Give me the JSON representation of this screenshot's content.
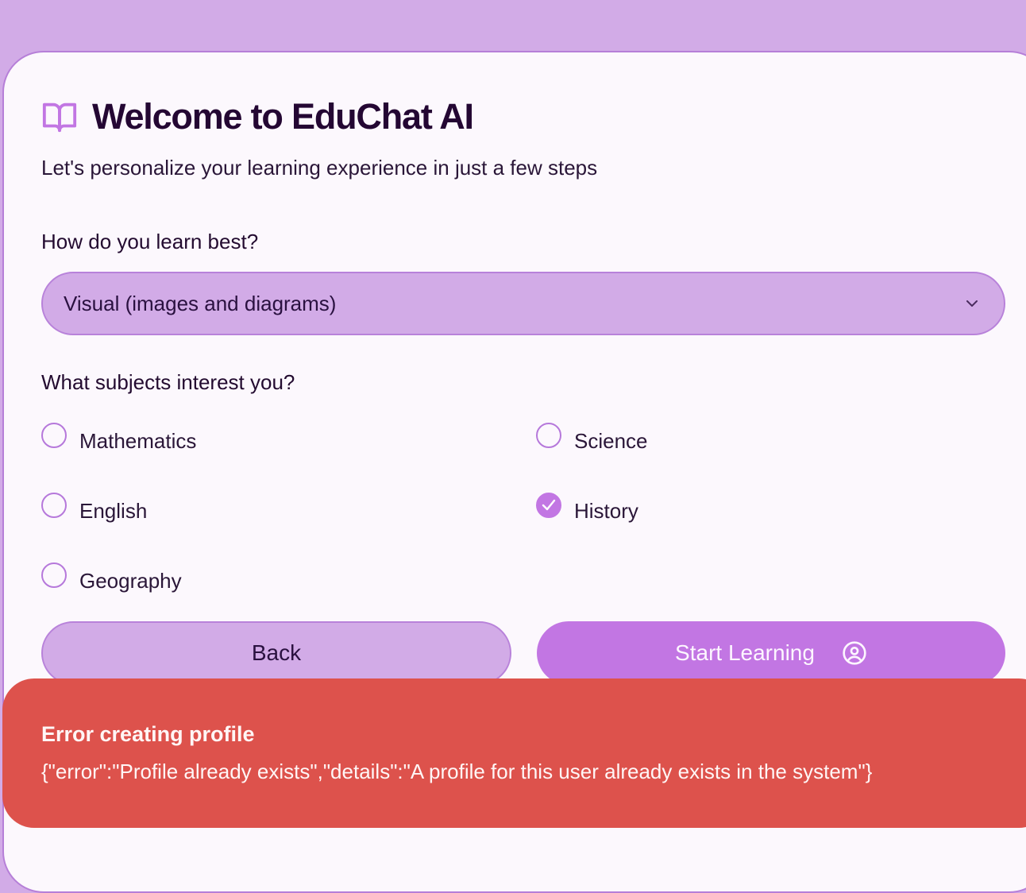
{
  "header": {
    "title": "Welcome to EduChat AI",
    "subtitle": "Let's personalize your learning experience in just a few steps",
    "icon": "book-open-icon"
  },
  "learning_style": {
    "label": "How do you learn best?",
    "selected": "Visual (images and diagrams)"
  },
  "subjects": {
    "label": "What subjects interest you?",
    "options": [
      {
        "label": "Mathematics",
        "checked": false
      },
      {
        "label": "Science",
        "checked": false
      },
      {
        "label": "English",
        "checked": false
      },
      {
        "label": "History",
        "checked": true
      },
      {
        "label": "Geography",
        "checked": false
      }
    ]
  },
  "actions": {
    "back_label": "Back",
    "start_label": "Start Learning"
  },
  "toast": {
    "title": "Error creating profile",
    "message": "{\"error\":\"Profile already exists\",\"details\":\"A profile for this user already exists in the system\"}"
  },
  "colors": {
    "background": "#d2abe7",
    "accent": "#c276e3",
    "error": "#dd524c",
    "card": "#fcf8fd"
  }
}
